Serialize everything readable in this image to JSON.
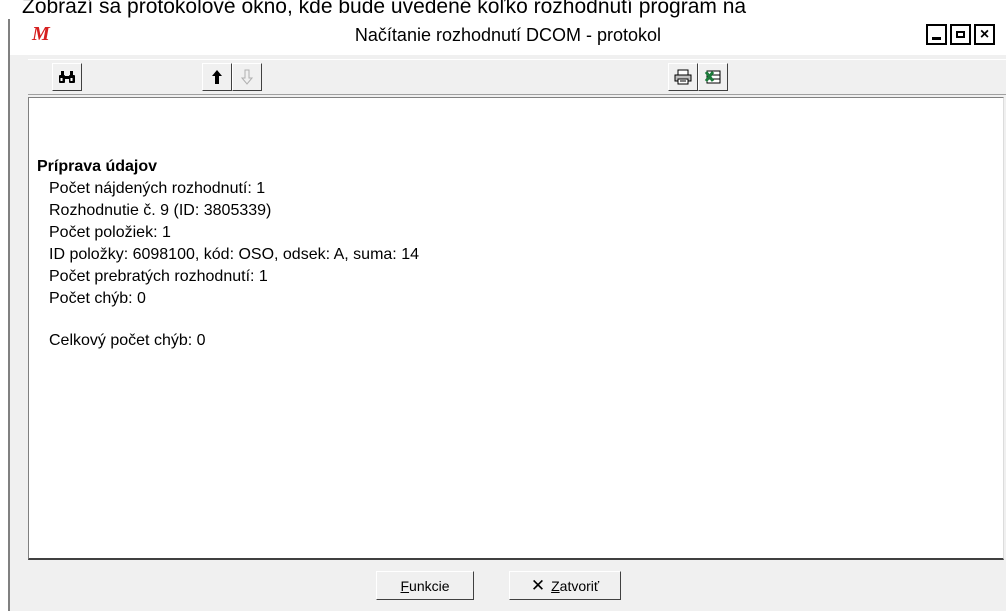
{
  "document": {
    "caption": "Zobrazí sa protokolové okno, kde bude uvedené koľko rozhodnutí program na"
  },
  "window": {
    "title": "Načítanie rozhodnutí DCOM - protokol",
    "app_icon": "M",
    "controls": {
      "minimize": "minimize-icon",
      "maximize": "maximize-icon",
      "close": "×"
    }
  },
  "toolbar": {
    "find_icon": "binoculars-icon",
    "up_icon": "🠉",
    "down_icon": "🠋",
    "print_icon": "🖶",
    "excel_icon": "excel-icon"
  },
  "log": {
    "heading": "Príprava údajov",
    "lines": [
      "Počet nájdených rozhodnutí: 1",
      "Rozhodnutie č. 9 (ID: 3805339)",
      "Počet položiek: 1",
      "ID položky: 6098100, kód: OSO, odsek: A, suma: 14",
      "Počet prebratých rozhodnutí: 1",
      "Počet chýb: 0"
    ],
    "total": "Celkový počet chýb: 0"
  },
  "buttons": {
    "funkcie": "Funkcie",
    "zatvorit": "Zatvoriť",
    "zatvorit_icon": "✕"
  }
}
